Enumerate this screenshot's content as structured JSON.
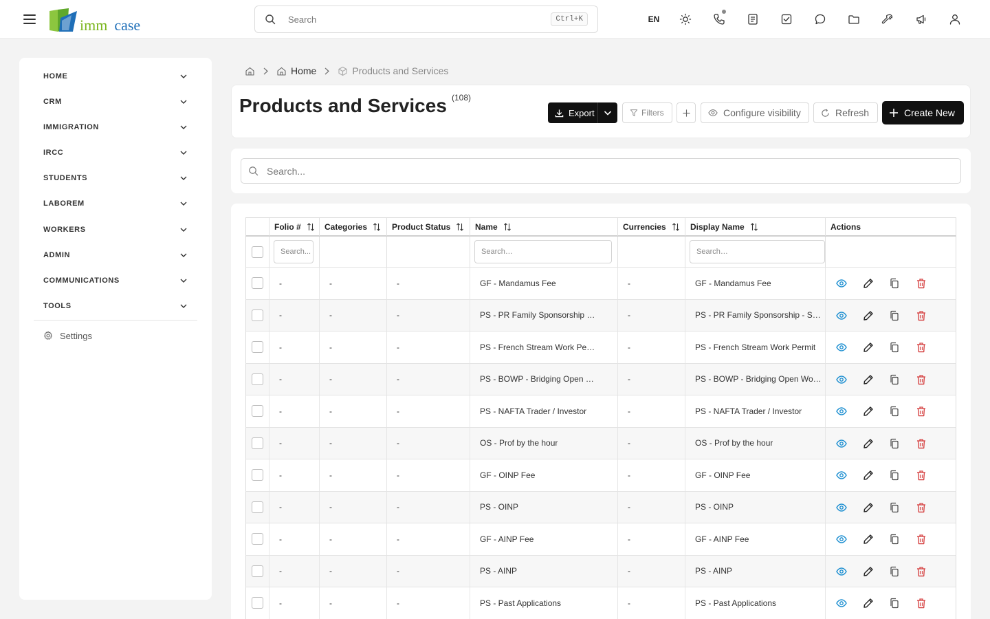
{
  "app": {
    "logo_text_1": "imm",
    "logo_text_2": "case",
    "search_placeholder": "Search",
    "search_shortcut": "Ctrl+K",
    "language": "EN"
  },
  "topbar_icons": [
    "sun-icon",
    "phone-icon",
    "notes-icon",
    "tasks-icon",
    "chat-icon",
    "folder-icon",
    "tools-icon",
    "megaphone-icon",
    "user-icon"
  ],
  "sidebar": {
    "items": [
      {
        "label": "HOME"
      },
      {
        "label": "CRM"
      },
      {
        "label": "IMMIGRATION"
      },
      {
        "label": "IRCC"
      },
      {
        "label": "STUDENTS"
      },
      {
        "label": "LABOREM"
      },
      {
        "label": "WORKERS"
      },
      {
        "label": "ADMIN"
      },
      {
        "label": "COMMUNICATIONS"
      },
      {
        "label": "TOOLS"
      }
    ],
    "settings_label": "Settings"
  },
  "breadcrumb": {
    "home": "Home",
    "current": "Products and Services"
  },
  "header": {
    "title": "Products and Services",
    "count": "(108)",
    "export_label": "Export",
    "filters_label": "Filters",
    "configure_label": "Configure visibility",
    "refresh_label": "Refresh",
    "create_label": "Create New"
  },
  "search": {
    "placeholder": "Search..."
  },
  "table": {
    "columns": [
      "Folio #",
      "Categories",
      "Product Status",
      "Name",
      "Currencies",
      "Display Name",
      "Actions"
    ],
    "filter_placeholders": {
      "folio": "Search...",
      "name": "Search…",
      "display_name": "Search…"
    },
    "rows": [
      {
        "folio": "-",
        "categories": "-",
        "status": "-",
        "name": "GF - Mandamus Fee",
        "currencies": "-",
        "display_name": "GF - Mandamus Fee"
      },
      {
        "folio": "-",
        "categories": "-",
        "status": "-",
        "name": "PS - PR Family Sponsorship - Spouse",
        "currencies": "-",
        "display_name": "PS - PR Family Sponsorship - Spouse"
      },
      {
        "folio": "-",
        "categories": "-",
        "status": "-",
        "name": "PS - French Stream Work Permit",
        "currencies": "-",
        "display_name": "PS - French Stream Work Permit"
      },
      {
        "folio": "-",
        "categories": "-",
        "status": "-",
        "name": "PS - BOWP - Bridging Open Work Permit",
        "currencies": "-",
        "display_name": "PS - BOWP - Bridging Open Work Permit"
      },
      {
        "folio": "-",
        "categories": "-",
        "status": "-",
        "name": "PS - NAFTA Trader / Investor",
        "currencies": "-",
        "display_name": "PS - NAFTA Trader / Investor"
      },
      {
        "folio": "-",
        "categories": "-",
        "status": "-",
        "name": "OS - Prof by the hour",
        "currencies": "-",
        "display_name": "OS - Prof by the hour"
      },
      {
        "folio": "-",
        "categories": "-",
        "status": "-",
        "name": "GF - OINP Fee",
        "currencies": "-",
        "display_name": "GF - OINP Fee"
      },
      {
        "folio": "-",
        "categories": "-",
        "status": "-",
        "name": "PS - OINP",
        "currencies": "-",
        "display_name": "PS - OINP"
      },
      {
        "folio": "-",
        "categories": "-",
        "status": "-",
        "name": "GF - AINP Fee",
        "currencies": "-",
        "display_name": "GF - AINP Fee"
      },
      {
        "folio": "-",
        "categories": "-",
        "status": "-",
        "name": "PS - AINP",
        "currencies": "-",
        "display_name": "PS - AINP"
      },
      {
        "folio": "-",
        "categories": "-",
        "status": "-",
        "name": "PS - Past Applications",
        "currencies": "-",
        "display_name": "PS - Past Applications"
      }
    ]
  },
  "colors": {
    "accent_dark": "#111111",
    "view_icon": "#1d8fd1",
    "delete_icon": "#d64545",
    "logo_green": "#7ab51d",
    "logo_blue": "#1f6fb8"
  }
}
